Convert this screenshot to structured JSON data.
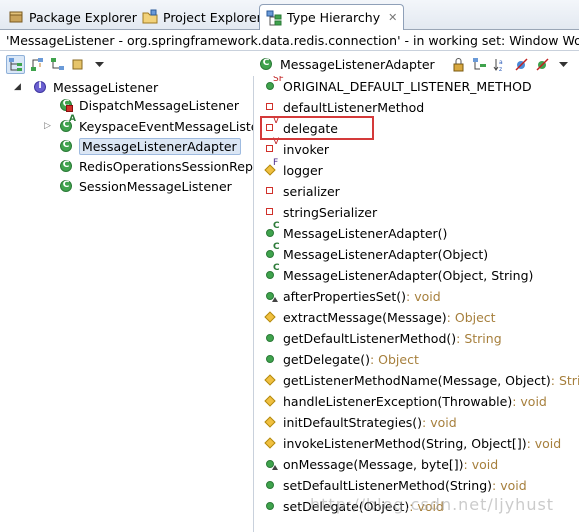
{
  "tabs": [
    {
      "label": "Package Explorer"
    },
    {
      "label": "Project Explorer"
    },
    {
      "label": "Type Hierarchy",
      "close": "✕"
    }
  ],
  "description": "'MessageListener - org.springframework.data.redis.connection' - in working set: Window Working",
  "hierarchy": {
    "root": "MessageListener",
    "children": [
      {
        "label": "DispatchMessageListener"
      },
      {
        "label": "KeyspaceEventMessageListe"
      },
      {
        "label": "MessageListenerAdapter"
      },
      {
        "label": "RedisOperationsSessionRep"
      },
      {
        "label": "SessionMessageListener"
      }
    ]
  },
  "members_header": "MessageListenerAdapter",
  "members": [
    {
      "name": "ORIGINAL_DEFAULT_LISTENER_METHOD",
      "ret": "",
      "sup": "SF"
    },
    {
      "name": "defaultListenerMethod",
      "ret": "",
      "sup": ""
    },
    {
      "name": "delegate",
      "ret": "",
      "sup": "V"
    },
    {
      "name": "invoker",
      "ret": "",
      "sup": "V"
    },
    {
      "name": "logger",
      "ret": "",
      "sup": "F"
    },
    {
      "name": "serializer",
      "ret": "",
      "sup": ""
    },
    {
      "name": "stringSerializer",
      "ret": "",
      "sup": ""
    },
    {
      "name": "MessageListenerAdapter()",
      "ret": "",
      "sup": "C"
    },
    {
      "name": "MessageListenerAdapter(Object)",
      "ret": "",
      "sup": "C"
    },
    {
      "name": "MessageListenerAdapter(Object, String)",
      "ret": "",
      "sup": "C"
    },
    {
      "name": "afterPropertiesSet()",
      "ret": " : void",
      "sup": ""
    },
    {
      "name": "extractMessage(Message)",
      "ret": " : Object",
      "sup": ""
    },
    {
      "name": "getDefaultListenerMethod()",
      "ret": " : String",
      "sup": ""
    },
    {
      "name": "getDelegate()",
      "ret": " : Object",
      "sup": ""
    },
    {
      "name": "getListenerMethodName(Message, Object)",
      "ret": " : String",
      "sup": ""
    },
    {
      "name": "handleListenerException(Throwable)",
      "ret": " : void",
      "sup": ""
    },
    {
      "name": "initDefaultStrategies()",
      "ret": " : void",
      "sup": ""
    },
    {
      "name": "invokeListenerMethod(String, Object[])",
      "ret": " : void",
      "sup": ""
    },
    {
      "name": "onMessage(Message, byte[])",
      "ret": " : void",
      "sup": ""
    },
    {
      "name": "setDefaultListenerMethod(String)",
      "ret": " : void",
      "sup": ""
    },
    {
      "name": "setDelegate(Object)",
      "ret": " : void",
      "sup": ""
    }
  ],
  "watermark": "http://blog.csdn.net/ljyhust"
}
